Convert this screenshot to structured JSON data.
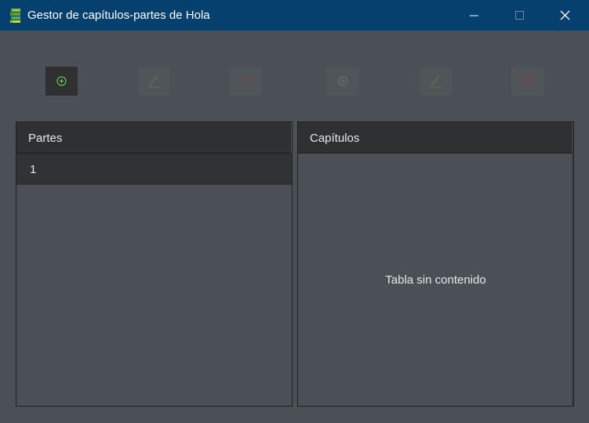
{
  "window": {
    "title": "Gestor de capítulos-partes de Hola",
    "icon": "books-icon",
    "controls": [
      "minimize-icon",
      "maximize-icon",
      "close-icon"
    ]
  },
  "toolbar": {
    "buttons": [
      {
        "name": "add-part-button",
        "icon": "plus-circle-icon",
        "enabled": true
      },
      {
        "name": "edit-part-button",
        "icon": "pencil-icon",
        "enabled": false
      },
      {
        "name": "delete-part-button",
        "icon": "trash-icon",
        "enabled": false
      },
      {
        "name": "add-chapter-button",
        "icon": "plus-circle-icon",
        "enabled": false
      },
      {
        "name": "edit-chapter-button",
        "icon": "pencil-icon",
        "enabled": false
      },
      {
        "name": "delete-chapter-button",
        "icon": "trash-icon",
        "enabled": false
      }
    ]
  },
  "parts_table": {
    "header": "Partes",
    "rows": [
      "1"
    ]
  },
  "chapters_table": {
    "header": "Capítulos",
    "rows": [],
    "empty_message": "Tabla sin contenido"
  },
  "colors": {
    "titlebar": "#06406f",
    "background": "#4b5056",
    "header": "#2f3031",
    "add_enabled": "#7bd66a",
    "delete_disabled": "#6b4a4a"
  }
}
